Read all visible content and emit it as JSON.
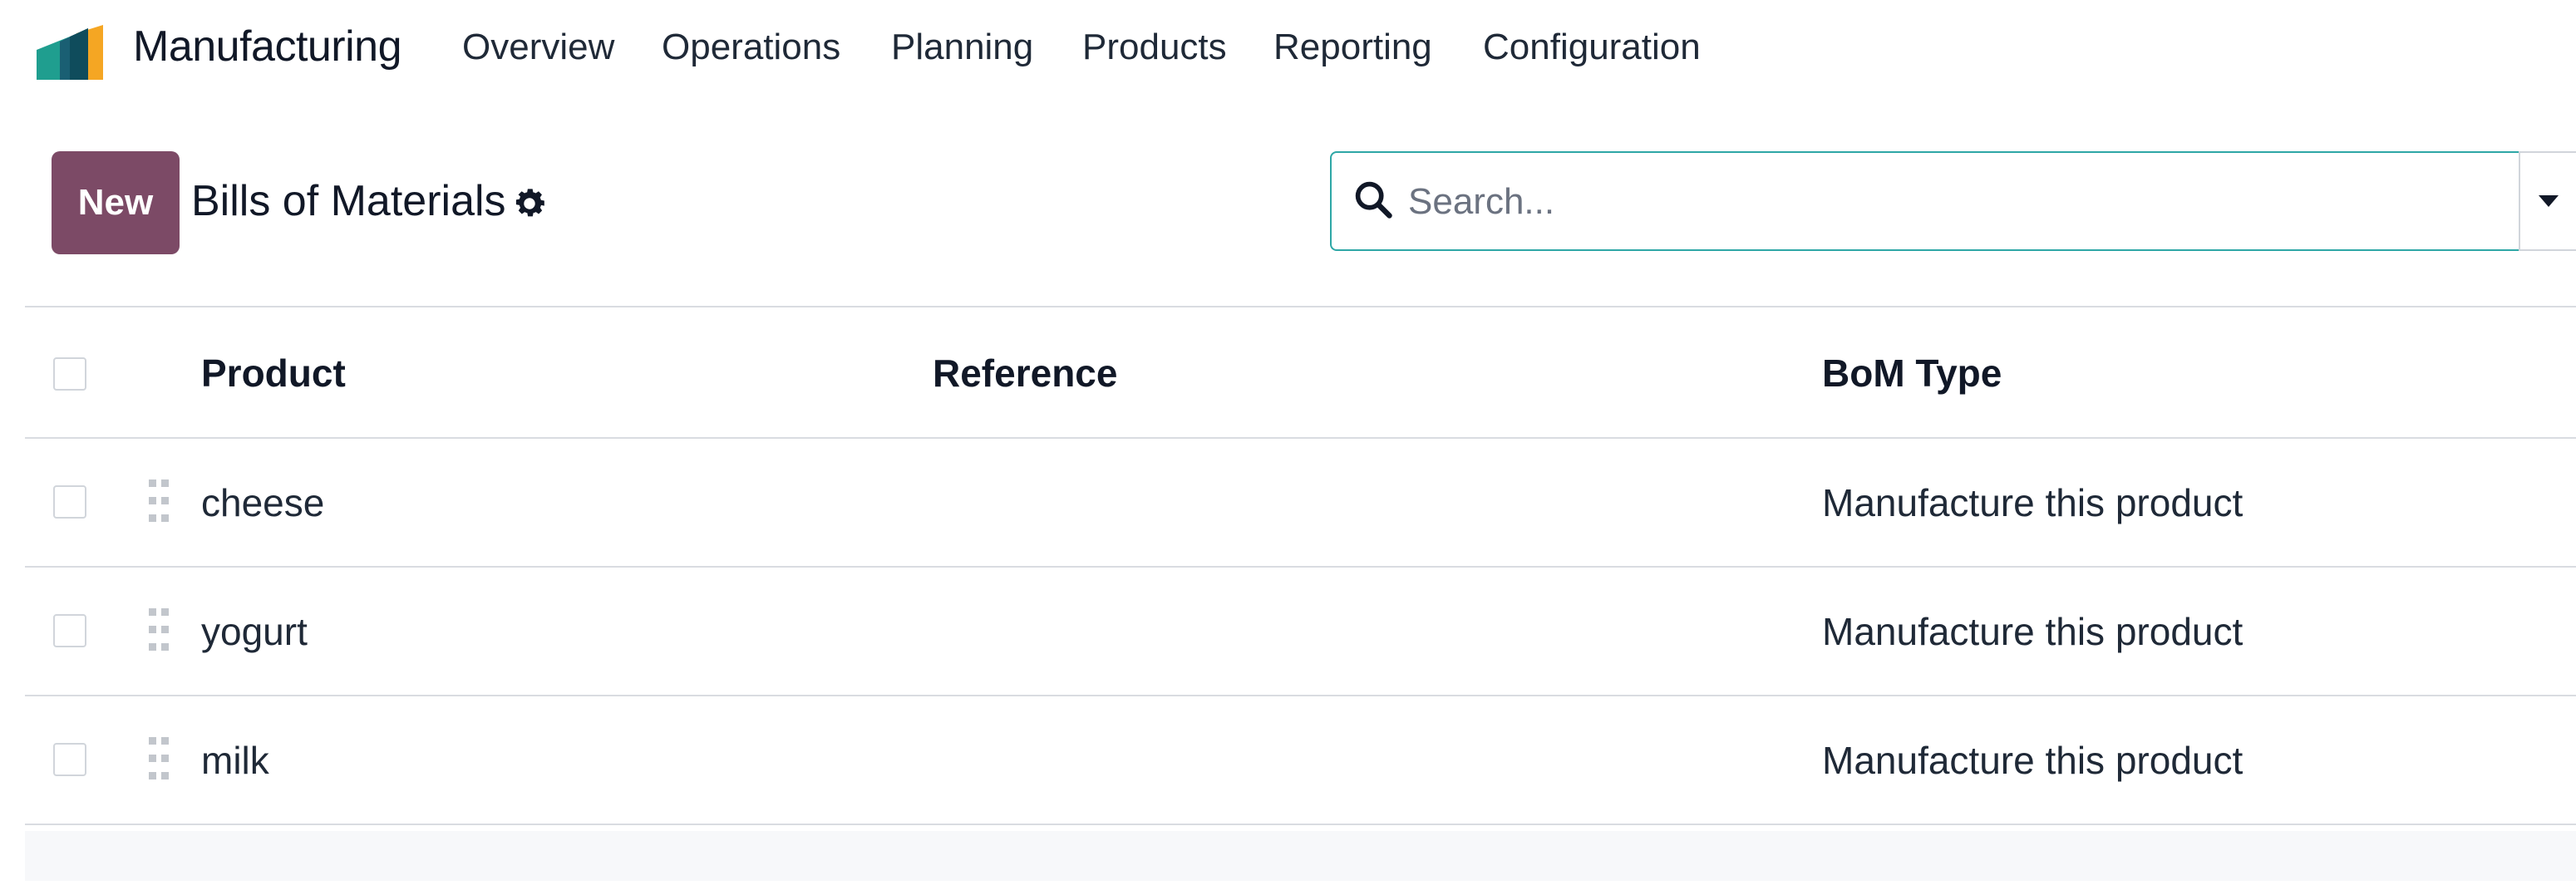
{
  "app": {
    "name": "Manufacturing",
    "logo_icon": "odoo-manufacturing-app-icon",
    "colors": {
      "brand": "#7c4a66",
      "accent": "#2ea7a6"
    }
  },
  "nav": {
    "items": [
      {
        "label": "Overview"
      },
      {
        "label": "Operations"
      },
      {
        "label": "Planning"
      },
      {
        "label": "Products"
      },
      {
        "label": "Reporting"
      },
      {
        "label": "Configuration"
      }
    ]
  },
  "control_panel": {
    "new_label": "New",
    "title": "Bills of Materials",
    "settings_icon": "gear-icon"
  },
  "search": {
    "placeholder": "Search...",
    "value": ""
  },
  "table": {
    "columns": [
      "Product",
      "Reference",
      "BoM Type"
    ],
    "rows": [
      {
        "product": "cheese",
        "reference": "",
        "bom_type": "Manufacture this product"
      },
      {
        "product": "yogurt",
        "reference": "",
        "bom_type": "Manufacture this product"
      },
      {
        "product": "milk",
        "reference": "",
        "bom_type": "Manufacture this product"
      }
    ]
  }
}
